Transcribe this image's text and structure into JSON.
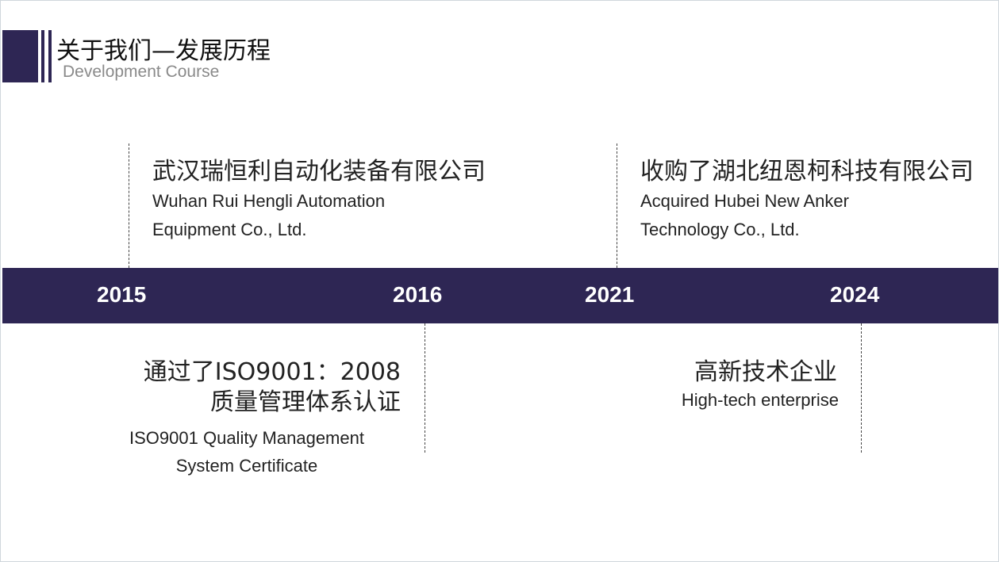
{
  "header": {
    "title": "关于我们—发展历程",
    "subtitle": "Development Course"
  },
  "timeline": {
    "years": [
      "2015",
      "2016",
      "2021",
      "2024"
    ]
  },
  "events": {
    "e2015": {
      "title": "武汉瑞恒利自动化装备有限公司",
      "desc_line1": "Wuhan Rui Hengli Automation",
      "desc_line2": "Equipment Co., Ltd."
    },
    "e2016": {
      "title_line1": "通过了ISO9001：2008",
      "title_line2": "质量管理体系认证",
      "desc_line1": "ISO9001 Quality Management",
      "desc_line2": "System Certificate"
    },
    "e2021": {
      "title": "收购了湖北纽恩柯科技有限公司",
      "desc_line1": "Acquired Hubei New Anker",
      "desc_line2": "Technology Co., Ltd."
    },
    "e2024": {
      "title": "高新技术企业",
      "desc": "High-tech enterprise"
    }
  },
  "colors": {
    "brand": "#2e2654"
  }
}
